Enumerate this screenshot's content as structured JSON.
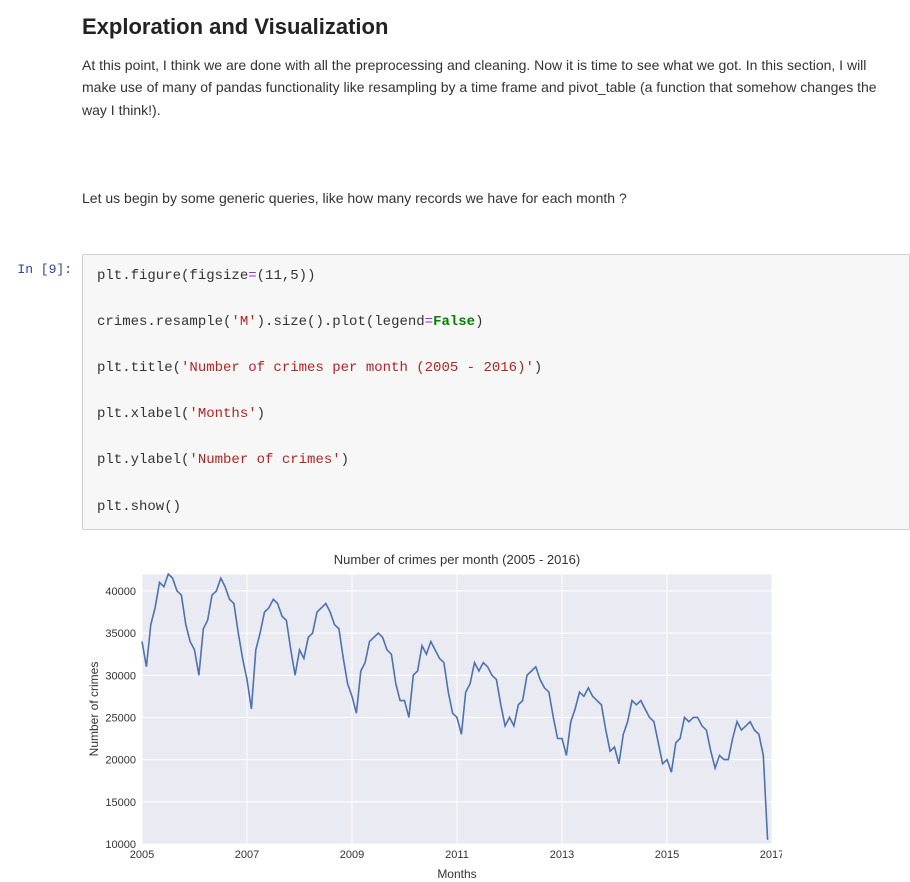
{
  "heading": "Exploration and Visualization",
  "para1": "At this point, I think we are done with all the preprocessing and cleaning. Now it is time to see what we got. In this section, I will make use of many of pandas functionality like resampling by a time frame and pivot_table (a function that somehow changes the way I think!).",
  "para2": "Let us begin by some generic queries, like how many records we have for each month ?",
  "prompt": "In [9]:",
  "code": {
    "l1a": "plt.figure(figsize",
    "l1eq": "=",
    "l1b": "(",
    "l1num": "11",
    "l1c": ",",
    "l1num2": "5",
    "l1d": "))",
    "l2a": "crimes.resample(",
    "l2s": "'M'",
    "l2b": ").size().plot(legend",
    "l2eq": "=",
    "l2kw": "False",
    "l2c": ")",
    "l3a": "plt.title(",
    "l3s": "'Number of crimes per month (2005 - 2016)'",
    "l3b": ")",
    "l4a": "plt.xlabel(",
    "l4s": "'Months'",
    "l4b": ")",
    "l5a": "plt.ylabel(",
    "l5s": "'Number of crimes'",
    "l5b": ")",
    "l6": "plt.show()"
  },
  "chart_data": {
    "type": "line",
    "title": "Number of crimes per month (2005 - 2016)",
    "xlabel": "Months",
    "ylabel": "Number of crimes",
    "ylim": [
      10000,
      42000
    ],
    "yticks": [
      10000,
      15000,
      20000,
      25000,
      30000,
      35000,
      40000
    ],
    "xlim": [
      "2005-01",
      "2017-01"
    ],
    "xticks": [
      2005,
      2007,
      2009,
      2011,
      2013,
      2015,
      2017
    ],
    "x_months_from_jan2005": [
      0,
      1,
      2,
      3,
      4,
      5,
      6,
      7,
      8,
      9,
      10,
      11,
      12,
      13,
      14,
      15,
      16,
      17,
      18,
      19,
      20,
      21,
      22,
      23,
      24,
      25,
      26,
      27,
      28,
      29,
      30,
      31,
      32,
      33,
      34,
      35,
      36,
      37,
      38,
      39,
      40,
      41,
      42,
      43,
      44,
      45,
      46,
      47,
      48,
      49,
      50,
      51,
      52,
      53,
      54,
      55,
      56,
      57,
      58,
      59,
      60,
      61,
      62,
      63,
      64,
      65,
      66,
      67,
      68,
      69,
      70,
      71,
      72,
      73,
      74,
      75,
      76,
      77,
      78,
      79,
      80,
      81,
      82,
      83,
      84,
      85,
      86,
      87,
      88,
      89,
      90,
      91,
      92,
      93,
      94,
      95,
      96,
      97,
      98,
      99,
      100,
      101,
      102,
      103,
      104,
      105,
      106,
      107,
      108,
      109,
      110,
      111,
      112,
      113,
      114,
      115,
      116,
      117,
      118,
      119,
      120,
      121,
      122,
      123,
      124,
      125,
      126,
      127,
      128,
      129,
      130,
      131,
      132,
      133,
      134,
      135,
      136,
      137,
      138,
      139,
      140,
      141,
      142,
      143
    ],
    "values": [
      34000,
      31000,
      36000,
      38000,
      41000,
      40500,
      42000,
      41500,
      40000,
      39500,
      36000,
      34000,
      33000,
      30000,
      35500,
      36500,
      39500,
      40000,
      41500,
      40500,
      39000,
      38500,
      35000,
      32000,
      29500,
      26000,
      33000,
      35000,
      37500,
      38000,
      39000,
      38500,
      37000,
      36500,
      33000,
      30000,
      33000,
      32000,
      34500,
      35000,
      37500,
      38000,
      38500,
      37500,
      36000,
      35500,
      32000,
      29000,
      27500,
      25500,
      30500,
      31500,
      34000,
      34500,
      35000,
      34500,
      33000,
      32500,
      29000,
      27000,
      27000,
      25000,
      30000,
      30500,
      33500,
      32500,
      34000,
      33000,
      32000,
      31500,
      28000,
      25500,
      25000,
      23000,
      28000,
      29000,
      31500,
      30500,
      31500,
      31000,
      30000,
      29500,
      26500,
      24000,
      25000,
      24000,
      26500,
      27000,
      30000,
      30500,
      31000,
      29500,
      28500,
      28000,
      25000,
      22500,
      22500,
      20500,
      24500,
      26000,
      28000,
      27500,
      28500,
      27500,
      27000,
      26500,
      23500,
      21000,
      21500,
      19500,
      23000,
      24500,
      27000,
      26500,
      27000,
      26000,
      25000,
      24500,
      22000,
      19500,
      20000,
      18500,
      22000,
      22500,
      25000,
      24500,
      25000,
      25000,
      24000,
      23500,
      21000,
      19000,
      20500,
      20000,
      20000,
      22500,
      24500,
      23500,
      24000,
      24500,
      23500,
      23000,
      20500,
      10500
    ]
  }
}
